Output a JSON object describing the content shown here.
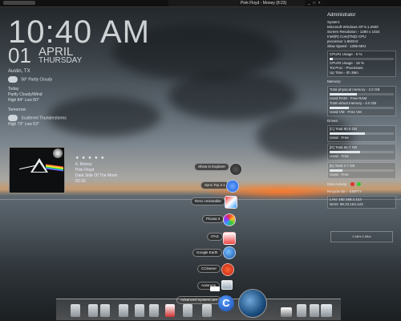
{
  "topbar": {
    "title": "Pink Floyd - Money (8:23)",
    "controls": "_ □ ×"
  },
  "clock": {
    "time": "10:40 AM",
    "day": "01",
    "month": "APRIL",
    "weekday": "THURSDAY"
  },
  "weather": {
    "city": "Austin, TX",
    "current_temp": "58°",
    "current_desc": "Partly Cloudy",
    "today_label": "Today",
    "today_desc": "Partly Cloudy/Wind",
    "today_range": "High 84° Low 60°",
    "tomorrow_label": "Tomorrow",
    "tomorrow_desc": "Scattered Thunderstorms",
    "tomorrow_range": "High 73° Low 53°"
  },
  "player": {
    "stars": "★ ★ ★ ★ ★",
    "track": "6. Money",
    "artist": "Pink Floyd",
    "album": "Dark Side Of The Moon",
    "time": "02:16"
  },
  "system": {
    "user": "Administrator",
    "system_label": "System:",
    "os": "Microsoft Windows XP 5.1.2600",
    "resolution": "Screen Resolution - 1280 x 1024",
    "cpu": "Intel(R) Core(TM)2 CPU",
    "processor": "processor          1.86GHz",
    "clock": "Slow Speed - 1296 MHz",
    "cpu_usage": "CPU#1 Usage - 5 %",
    "cpu2_usage": "CPU#2 Usage - 18 %",
    "tot_proc": "Tot Proc - Processes",
    "uptime": "Up Time - 0h 39m",
    "memory_label": "Memory:",
    "phys": "Total physical memory - 2.0 GB",
    "used_ram": "Used RAM",
    "free_ram": "Free RAM",
    "virt": "Total virtual memory - 4.0 GB",
    "used_vm": "Used VM",
    "free_vm": "Free VM",
    "drives_label": "Drives:",
    "drive_c": "[C] Total 80.0 GB",
    "drive_c_used": "Used",
    "drive_c_free": "Free",
    "drive_d": "[D] Total 94.7 GB",
    "drive_d_used": "Used",
    "drive_d_free": "Free",
    "drive_e": "[E] Total 3.7 GB",
    "drive_e_used": "Used",
    "drive_e_free": "Free",
    "disk_activity": "Disk Activity:",
    "recycle": "Recycle Bin - EMPTY",
    "ip_local": "LAN: 192.168.1.113",
    "ip_wan": "WAN: 99.23.154.123",
    "graph_caption": "0 kB/s          0 kB/s",
    "cpu_usage_pct": 5,
    "mem_used_pct": 42,
    "vm_used_pct": 30,
    "drive_c_pct": 55,
    "drive_d_pct": 48,
    "drive_e_pct": 20
  },
  "launcher": {
    "items": [
      {
        "label": "Show in Explorer",
        "icon": "pointer-icon"
      },
      {
        "label": "Sync.Toy 2.1",
        "icon": "sync-icon"
      },
      {
        "label": "Revo Uninstaller",
        "icon": "uninstall-icon"
      },
      {
        "label": "Picasa 3",
        "icon": "picasa-icon"
      },
      {
        "label": "ITAS",
        "icon": "itas-icon"
      },
      {
        "label": "Google Earth",
        "icon": "globe-icon"
      },
      {
        "label": "CCleaner",
        "icon": "ccleaner-icon"
      },
      {
        "label": "Autoruns",
        "icon": "autoruns-icon"
      },
      {
        "label": "Advanced SystemCare",
        "icon": "systemcare-icon"
      }
    ]
  },
  "colors": {
    "sunset": "#ff7828",
    "accent": "#1446a8"
  }
}
